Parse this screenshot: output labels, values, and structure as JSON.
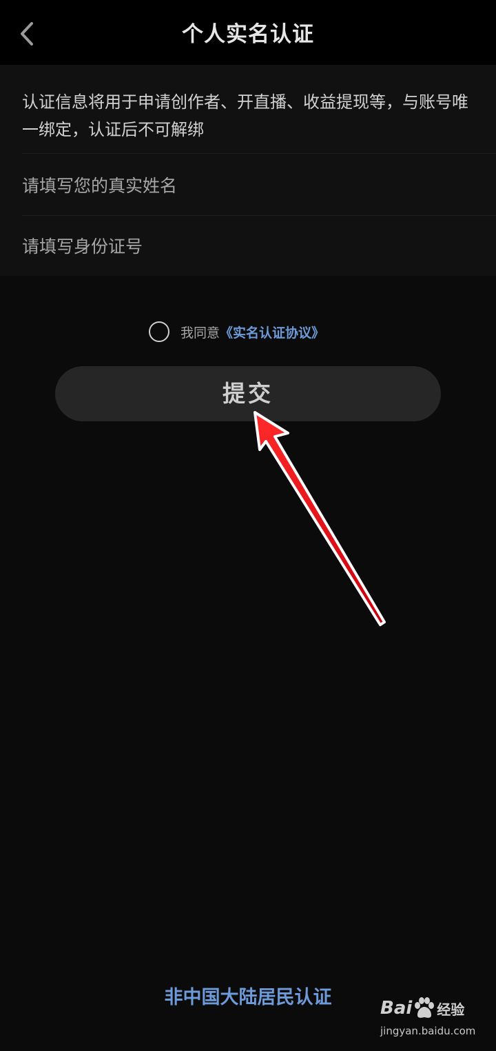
{
  "header": {
    "title": "个人实名认证",
    "back_icon": "chevron-left-icon"
  },
  "form": {
    "notice": "认证信息将用于申请创作者、开直播、收益提现等，与账号唯一绑定，认证后不可解绑",
    "name_field": {
      "value": "",
      "placeholder": "请填写您的真实姓名"
    },
    "id_field": {
      "value": "",
      "placeholder": "请填写身份证号"
    }
  },
  "agreement": {
    "checked": false,
    "prefix": "我同意",
    "link_label": "《实名认证协议》"
  },
  "submit_label": "提交",
  "footer_link": "非中国大陆居民认证",
  "watermark": {
    "brand": "Bai",
    "product": "经验",
    "url": "jingyan.baidu.com"
  },
  "colors": {
    "background": "#0b0b0b",
    "card": "#111111",
    "link": "#6d9ad8",
    "button": "#262626",
    "annotation_arrow": "#e8101a"
  }
}
